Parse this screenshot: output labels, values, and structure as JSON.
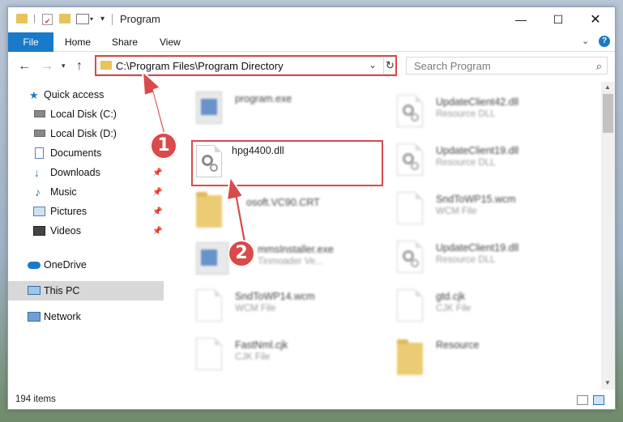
{
  "window": {
    "title": "Program"
  },
  "ribbon": {
    "file": "File",
    "home": "Home",
    "share": "Share",
    "view": "View"
  },
  "nav": {
    "address": "C:\\Program Files\\Program Directory",
    "search_placeholder": "Search Program"
  },
  "sidebar": {
    "items": [
      {
        "label": "Quick access",
        "icon": "star-icon"
      },
      {
        "label": "Local Disk (C:)",
        "icon": "drive-icon"
      },
      {
        "label": "Local Disk (D:)",
        "icon": "drive-icon"
      },
      {
        "label": "Documents",
        "icon": "documents-icon"
      },
      {
        "label": "Downloads",
        "icon": "download-icon"
      },
      {
        "label": "Music",
        "icon": "music-icon"
      },
      {
        "label": "Pictures",
        "icon": "pictures-icon"
      },
      {
        "label": "Videos",
        "icon": "videos-icon"
      },
      {
        "label": "OneDrive",
        "icon": "cloud-icon"
      },
      {
        "label": "This PC",
        "icon": "computer-icon"
      },
      {
        "label": "Network",
        "icon": "network-icon"
      }
    ]
  },
  "files": {
    "left": [
      {
        "name": "program.exe",
        "type": ""
      },
      {
        "name": "hpg4400.dll",
        "type": ""
      },
      {
        "name": "osoft.VC90.CRT",
        "type": ""
      },
      {
        "name": "mmsInstaller.exe",
        "type": "Tinmoader Ve..."
      },
      {
        "name": "SndToWP14.wcm",
        "type": "WCM File"
      },
      {
        "name": "FastNml.cjk",
        "type": "CJK File"
      }
    ],
    "right": [
      {
        "name": "UpdateClient42.dll",
        "type": "Resource DLL"
      },
      {
        "name": "UpdateClient19.dll",
        "type": "Resource DLL"
      },
      {
        "name": "SndToWP15.wcm",
        "type": "WCM File"
      },
      {
        "name": "UpdateClient19.dll",
        "type": "Resource DLL"
      },
      {
        "name": "gtd.cjk",
        "type": "CJK File"
      },
      {
        "name": "Resource",
        "type": ""
      }
    ]
  },
  "annotations": {
    "step1": "1",
    "step2": "2"
  },
  "status": {
    "item_count": "194 items"
  },
  "colors": {
    "accent": "#1979ca",
    "highlight": "#d94a4a"
  }
}
